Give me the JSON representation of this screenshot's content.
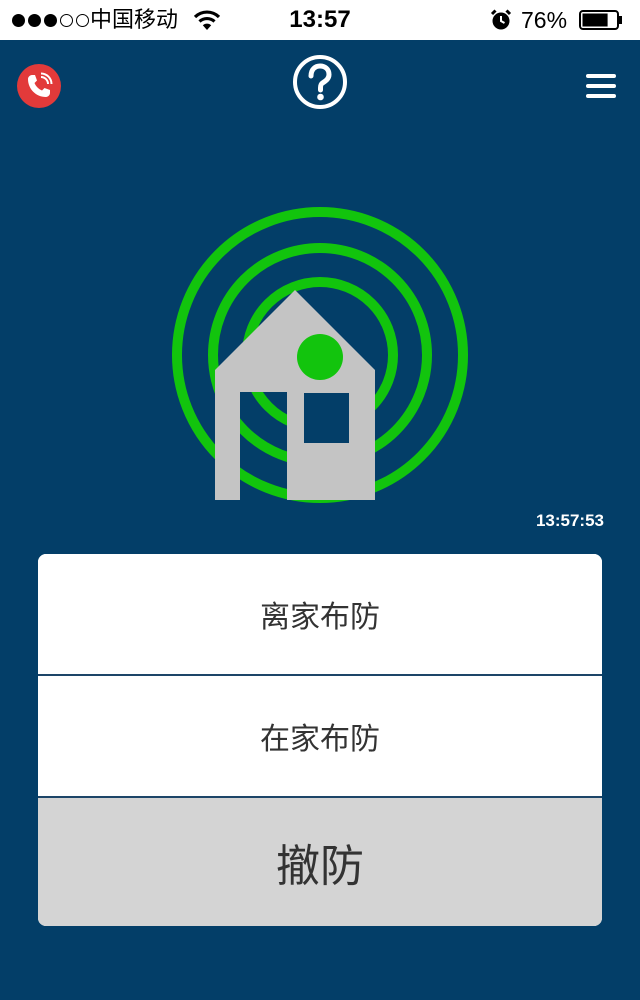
{
  "status_bar": {
    "signal_full": 3,
    "signal_empty": 2,
    "carrier": "中国移动",
    "time": "13:57",
    "battery_percent": "76%",
    "battery_level": 0.76
  },
  "header": {
    "call_icon": "phone-icon",
    "help_icon": "question-mark-icon",
    "menu_icon": "hamburger-menu-icon"
  },
  "status": {
    "graphic_icon": "house-signal-icon",
    "clock": "13:57:53"
  },
  "arm_buttons": {
    "away_label": "离家布防",
    "home_label": "在家布防",
    "disarm_label": "撤防"
  },
  "colors": {
    "background": "#033e68",
    "signal_green": "#12c40d",
    "house_gray": "#c4c4c4",
    "call_red": "#e23a3a",
    "disarm_gray": "#d4d4d4"
  }
}
